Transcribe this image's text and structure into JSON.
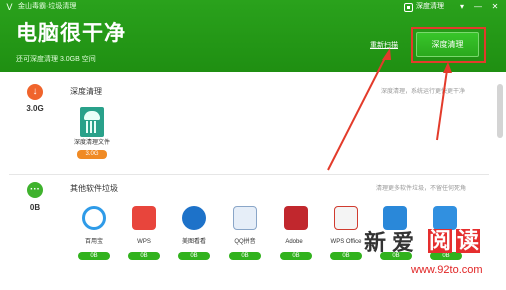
{
  "window": {
    "app_title": "金山毒霸·垃圾清理",
    "top_right_label": "深度清理",
    "controls": [
      "▾",
      "—",
      "✕"
    ]
  },
  "header": {
    "title": "电脑很干净",
    "subtitle": "还可深度清理 3.0GB 空间",
    "rescan_label": "重新扫描",
    "deep_clean_button": "深度清理"
  },
  "sections": [
    {
      "size": "3.0G",
      "title": "深度清理",
      "description": "深度清理，系统运行更快更干净",
      "icon_color": "#f0642c",
      "items": [
        {
          "label": "深度清理文件",
          "size": "3.0G",
          "badge_color": "#f08a24"
        }
      ]
    },
    {
      "size": "0B",
      "title": "其他软件垃圾",
      "description": "清理更多软件垃圾，不留任何死角",
      "icon_color": "#3fb22d",
      "items": [
        {
          "label": "百用宝",
          "size": "0B",
          "icon": "baiyongbao-icon"
        },
        {
          "label": "WPS",
          "size": "0B",
          "icon": "wps-icon"
        },
        {
          "label": "美图看看",
          "size": "0B",
          "icon": "meitu-icon"
        },
        {
          "label": "QQ拼音",
          "size": "0B",
          "icon": "qq-pinyin-icon"
        },
        {
          "label": "Adobe",
          "size": "0B",
          "icon": "adobe-icon"
        },
        {
          "label": "WPS Office",
          "size": "0B",
          "icon": "wps-office-icon"
        },
        {
          "label": "",
          "size": "0B",
          "icon": "sync-icon"
        },
        {
          "label": "",
          "size": "0B",
          "icon": "app-store-icon"
        }
      ]
    }
  ],
  "watermark": {
    "chars": [
      "新",
      "爱",
      "阅",
      "读"
    ],
    "url": "www.92to.com"
  },
  "colors": {
    "header_green": "#2aa21c",
    "highlight_red": "#e33b2b",
    "badge_green": "#31b21d",
    "badge_orange": "#f08a24"
  }
}
